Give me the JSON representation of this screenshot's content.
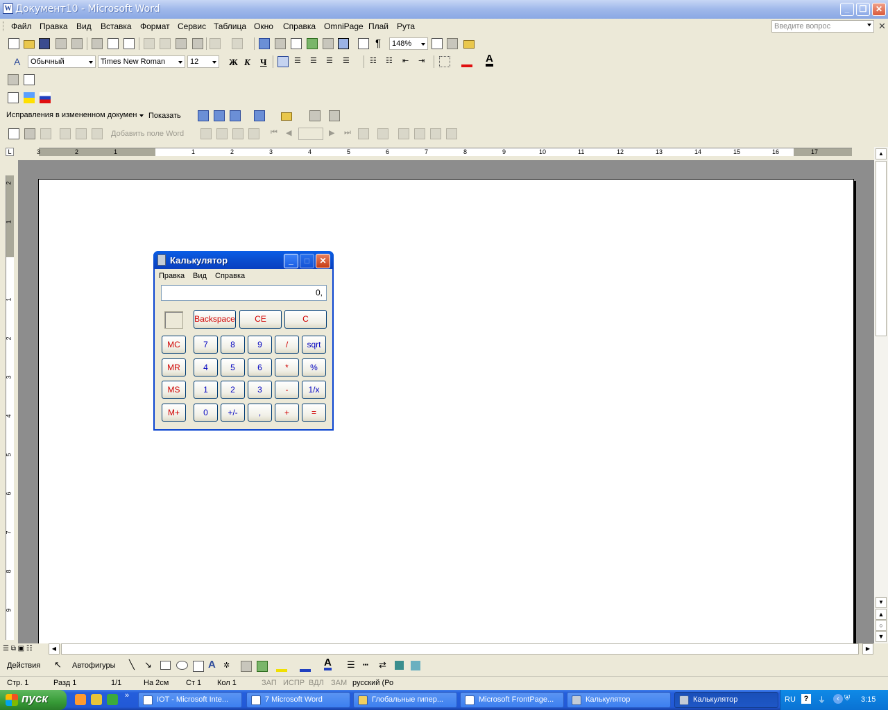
{
  "window": {
    "title": "Документ10 - Microsoft Word"
  },
  "menu": [
    "Файл",
    "Правка",
    "Вид",
    "Вставка",
    "Формат",
    "Сервис",
    "Таблица",
    "Окно",
    "Справка",
    "OmniPage",
    "Плай",
    "Рута"
  ],
  "ask_placeholder": "Введите вопрос",
  "standard_toolbar": {
    "zoom": "148%"
  },
  "format_toolbar": {
    "style": "Обычный",
    "font": "Times New Roman",
    "size": "12",
    "bold": "Ж",
    "italic": "К",
    "underline": "Ч"
  },
  "review_toolbar": {
    "display_mode": "Исправления в измененном докумен",
    "show_label": "Показать"
  },
  "mailmerge_toolbar": {
    "insert_field": "Добавить поле Word"
  },
  "ruler": {
    "h_labels": [
      "3",
      "2",
      "1",
      "1",
      "2",
      "3",
      "4",
      "5",
      "6",
      "7",
      "8",
      "9",
      "10",
      "11",
      "12",
      "13",
      "14",
      "15",
      "16",
      "17"
    ],
    "v_labels": [
      "2",
      "1",
      "1",
      "2",
      "3",
      "4",
      "5",
      "6",
      "7",
      "8",
      "9"
    ]
  },
  "draw_toolbar": {
    "actions": "Действия",
    "autoshapes": "Автофигуры"
  },
  "status": {
    "page": "Стр. 1",
    "section": "Разд 1",
    "pages": "1/1",
    "at": "На 2см",
    "line": "Ст 1",
    "col": "Кол 1",
    "rec": "ЗАП",
    "trk": "ИСПР",
    "ext": "ВДЛ",
    "ovr": "ЗАМ",
    "lang": "русский (Ро"
  },
  "taskbar": {
    "start": "пуск",
    "tasks": [
      "IOT - Microsoft Inte...",
      "7 Microsoft Word",
      "Глобальные гипер...",
      "Microsoft FrontPage...",
      "Калькулятор",
      "Калькулятор"
    ],
    "lang": "RU",
    "clock": "3:15"
  },
  "calculator": {
    "title": "Калькулятор",
    "menu": [
      "Правка",
      "Вид",
      "Справка"
    ],
    "display": "0,",
    "backspace": "Backspace",
    "ce": "CE",
    "c": "C",
    "mem": [
      "MC",
      "MR",
      "MS",
      "M+"
    ],
    "rows": [
      [
        "7",
        "8",
        "9",
        "/",
        "sqrt"
      ],
      [
        "4",
        "5",
        "6",
        "*",
        "%"
      ],
      [
        "1",
        "2",
        "3",
        "-",
        "1/x"
      ],
      [
        "0",
        "+/-",
        ",",
        "+",
        "="
      ]
    ]
  },
  "colors": {
    "titlebar": "#0a4fd1",
    "calc_red": "#d00000",
    "calc_blue": "#0000c0",
    "taskbar": "#245edc",
    "workspace": "#8d8d8d"
  }
}
